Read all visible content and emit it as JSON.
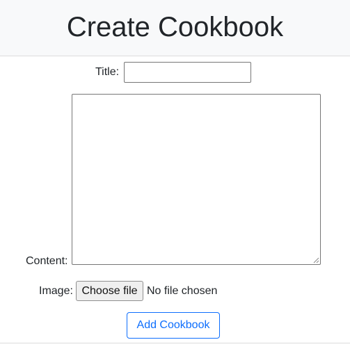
{
  "header": {
    "title": "Create Cookbook"
  },
  "form": {
    "title_label": "Title:",
    "title_value": "",
    "content_label": "Content:",
    "content_value": "",
    "image_label": "Image:",
    "file_button_label": "Choose file",
    "file_status": "No file chosen",
    "submit_label": "Add Cookbook"
  },
  "colors": {
    "header_background": "#f8f9fa",
    "primary": "#0d6efd",
    "text": "#212529"
  },
  "icons": {
    "textarea_resize": "resize-handle-icon"
  }
}
